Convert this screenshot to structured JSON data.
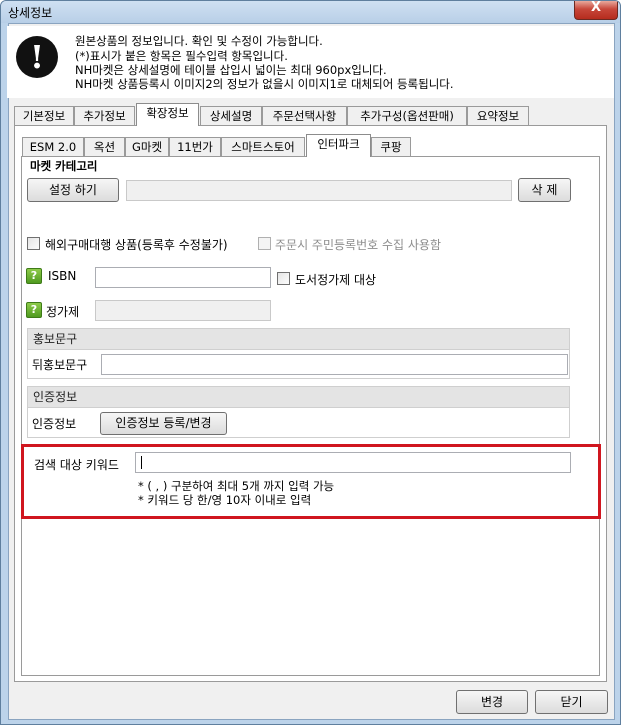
{
  "window": {
    "title": "상세정보",
    "close_label": "X"
  },
  "info": {
    "icon_symbol": "!",
    "lines": [
      "원본상품의 정보입니다. 확인 및 수정이 가능합니다.",
      "(*)표시가 붙은 항목은 필수입력 항목입니다.",
      "NH마켓은 상세설명에 테이블 삽입시 넓이는 최대 960px입니다.",
      "NH마켓 상품등록시 이미지2의 정보가 없을시 이미지1로 대체되어 등록됩니다."
    ]
  },
  "main_tabs": [
    "기본정보",
    "추가정보",
    "확장정보",
    "상세설명",
    "주문선택사항",
    "추가구성(옵션판매)",
    "요약정보"
  ],
  "main_tabs_active": "확장정보",
  "market_tabs": [
    "ESM 2.0",
    "옥션",
    "G마켓",
    "11번가",
    "스마트스토어",
    "인터파크",
    "쿠팡"
  ],
  "market_tabs_active": "인터파크",
  "category": {
    "title": "마켓 카테고리",
    "set_button": "설정 하기",
    "delete_button": "삭 제",
    "value": ""
  },
  "options": {
    "overseas_label": "해외구매대행 상품(등록후 수정불가)",
    "overseas_checked": false,
    "resident_id_label": "주문시 주민등록번호 수집 사용함",
    "resident_id_checked": false
  },
  "isbn": {
    "help_symbol": "?",
    "label": "ISBN",
    "value": "",
    "book_price_label": "도서정가제 대상",
    "book_price_checked": false
  },
  "list_price": {
    "help_symbol": "?",
    "label": "정가제",
    "value": ""
  },
  "promo": {
    "header": "홍보문구",
    "label": "뒤홍보문구",
    "value": ""
  },
  "cert": {
    "header": "인증정보",
    "label": "인증정보",
    "button": "인증정보 등록/변경"
  },
  "keywords": {
    "label": "검색 대상 키워드",
    "value": "",
    "note1": "* ( , ) 구분하여 최대 5개 까지 입력 가능",
    "note2": "* 키워드 당 한/영 10자 이내로 입력"
  },
  "footer": {
    "change_button": "변경",
    "close_button": "닫기"
  },
  "colors": {
    "highlight_border": "#d0161f",
    "window_frame": "#bcd3ea"
  }
}
